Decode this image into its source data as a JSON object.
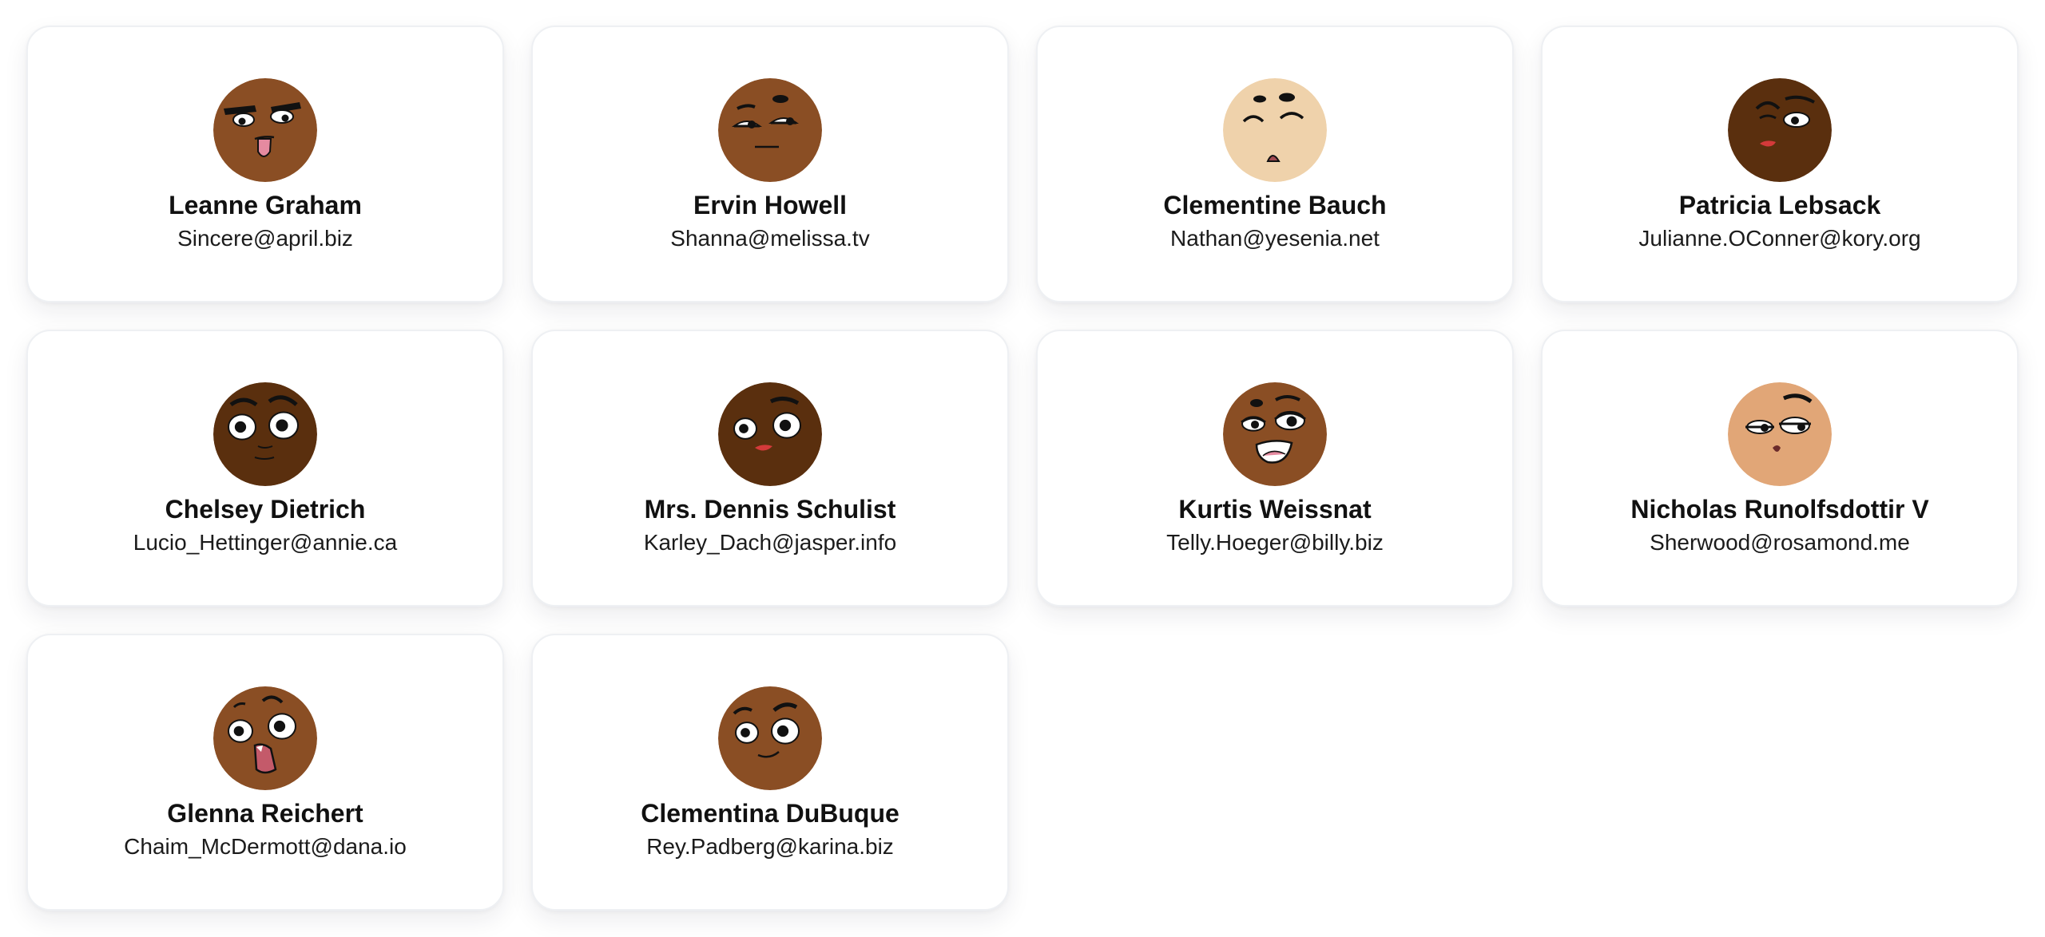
{
  "users": [
    {
      "name": "Leanne Graham",
      "email": "Sincere@april.biz",
      "skin": "#8a4e24",
      "avatar_icon": "grinning-tongue-face-icon"
    },
    {
      "name": "Ervin Howell",
      "email": "Shanna@melissa.tv",
      "skin": "#8a4e24",
      "avatar_icon": "skeptical-face-icon"
    },
    {
      "name": "Clementine Bauch",
      "email": "Nathan@yesenia.net",
      "skin": "#efd2ab",
      "avatar_icon": "squinting-face-icon"
    },
    {
      "name": "Patricia Lebsack",
      "email": "Julianne.OConner@kory.org",
      "skin": "#5a2f0e",
      "avatar_icon": "winking-face-icon"
    },
    {
      "name": "Chelsey Dietrich",
      "email": "Lucio_Hettinger@annie.ca",
      "skin": "#5a2f0e",
      "avatar_icon": "surprised-face-icon"
    },
    {
      "name": "Mrs. Dennis Schulist",
      "email": "Karley_Dach@jasper.info",
      "skin": "#5a2f0e",
      "avatar_icon": "smirking-face-icon"
    },
    {
      "name": "Kurtis Weissnat",
      "email": "Telly.Hoeger@billy.biz",
      "skin": "#8a4e24",
      "avatar_icon": "laughing-face-icon"
    },
    {
      "name": "Nicholas Runolfsdottir V",
      "email": "Sherwood@rosamond.me",
      "skin": "#e1a677",
      "avatar_icon": "sleepy-face-icon"
    },
    {
      "name": "Glenna Reichert",
      "email": "Chaim_McDermott@dana.io",
      "skin": "#8a4e24",
      "avatar_icon": "shocked-face-icon"
    },
    {
      "name": "Clementina DuBuque",
      "email": "Rey.Padberg@karina.biz",
      "skin": "#8a4e24",
      "avatar_icon": "smiling-face-icon"
    }
  ]
}
